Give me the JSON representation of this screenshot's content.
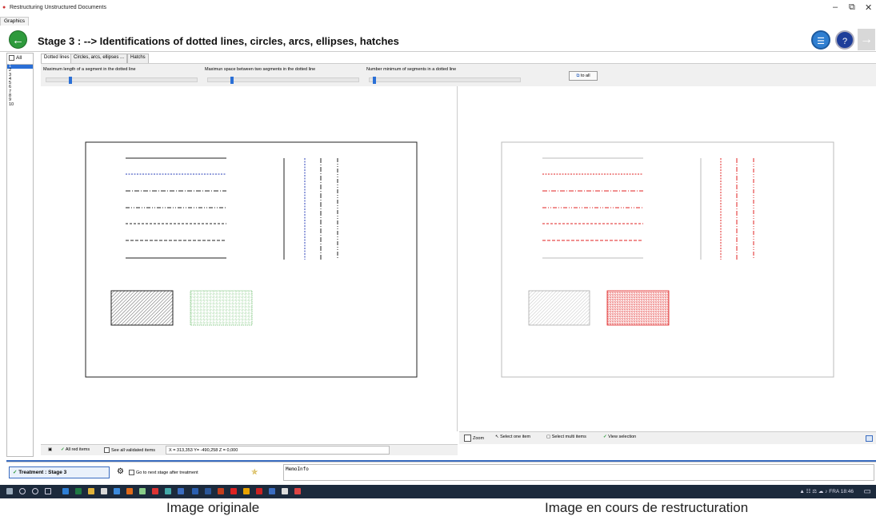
{
  "window": {
    "title": "Restructuring Unstructured Documents",
    "minimize": "–",
    "restore": "⧉",
    "close": "✕"
  },
  "menu": {
    "graphics": "Graphics"
  },
  "stage": {
    "title": "Stage 3  :  --> Identifications of dotted lines, circles, arcs, ellipses, hatches",
    "back_icon": "arrow-left-icon",
    "forward_icon": "arrow-right-icon"
  },
  "left_list": {
    "all_label": "All",
    "items": [
      "1",
      "2",
      "3",
      "4",
      "5",
      "6",
      "7",
      "8",
      "9",
      "10"
    ],
    "selected_index": 0
  },
  "tabs": [
    {
      "label": "Dotted lines",
      "active": true
    },
    {
      "label": "Circles, arcs, ellipses ...",
      "active": false
    },
    {
      "label": "Hatchs",
      "active": false
    }
  ],
  "params": {
    "max_segment_length": {
      "label": "Maximum length of a segment in the dotted line",
      "level": 0.15
    },
    "max_space": {
      "label": "Maximun space between two segments in the dotted line",
      "level": 0.15
    },
    "min_segments": {
      "label": "Number minimum of segments in a dotted line",
      "level": 0.02
    },
    "to_all_label": "to all"
  },
  "bottom_left": {
    "all_red_items": "All red items",
    "see_all_validated": "See all validated items",
    "coords": "X = 313,353  Y= -490,258  Z = 0,000"
  },
  "bottom_right": {
    "zoom": "Zoom",
    "select_one": "Select one item",
    "select_multi": "Select multi items",
    "view_selection": "View selection"
  },
  "treatment": {
    "button_label": "Treatment : Stage 3",
    "go_next_label": "Go to next stage after treatment",
    "memo": "MemoInfo"
  },
  "taskbar": {
    "tray_text": "FRA",
    "time": "18:46"
  },
  "captions": {
    "left": "Image originale",
    "right": "Image en cours de restructuration"
  },
  "colors": {
    "accent_blue": "#3a6cc0",
    "back_green": "#2e9a3c",
    "dotted_red": "#e02020"
  }
}
